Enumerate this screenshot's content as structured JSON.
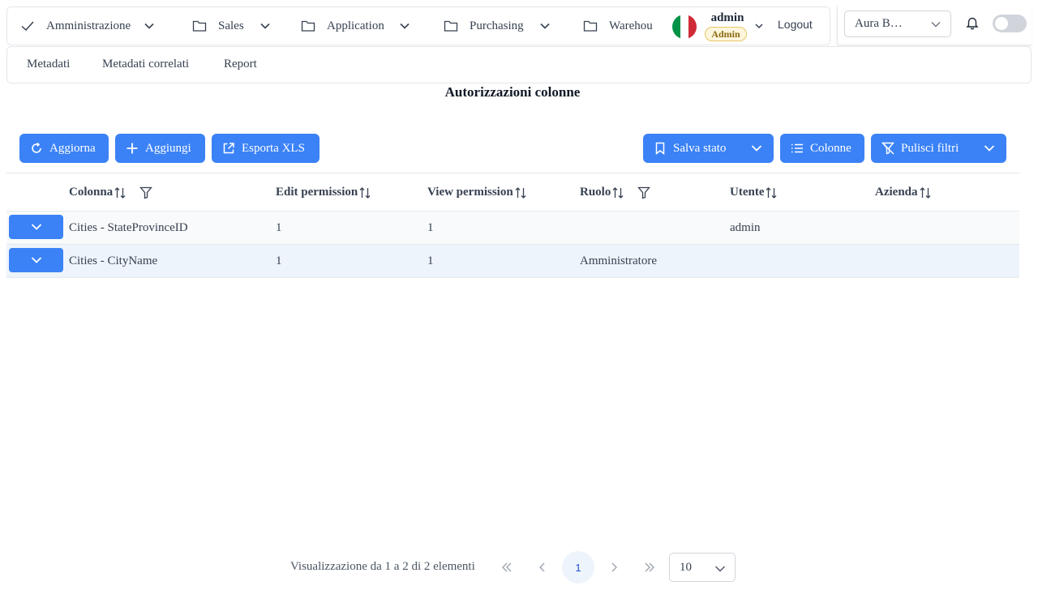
{
  "nav": {
    "items": [
      {
        "label": "Amministrazione",
        "icon": "check-icon"
      },
      {
        "label": "Sales",
        "icon": "folder-icon"
      },
      {
        "label": "Application",
        "icon": "folder-icon"
      },
      {
        "label": "Purchasing",
        "icon": "folder-icon"
      },
      {
        "label": "Warehou",
        "icon": "folder-icon"
      }
    ],
    "user": {
      "name": "admin",
      "role": "Admin",
      "flag": "italy-flag"
    },
    "logout_label": "Logout"
  },
  "company_select": {
    "value": "Aura B…"
  },
  "submenu": {
    "tabs": [
      "Metadati",
      "Metadati correlati",
      "Report"
    ]
  },
  "page_title": "Autorizzazioni colonne",
  "toolbar": {
    "refresh": "Aggiorna",
    "add": "Aggiungi",
    "export": "Esporta XLS",
    "save_state": "Salva stato",
    "columns": "Colonne",
    "clear_filters": "Pulisci filtri"
  },
  "table": {
    "columns": [
      {
        "label": "Colonna",
        "filter": true
      },
      {
        "label": "Edit permission",
        "filter": false
      },
      {
        "label": "View permission",
        "filter": false
      },
      {
        "label": "Ruolo",
        "filter": true
      },
      {
        "label": "Utente",
        "filter": false
      },
      {
        "label": "Azienda",
        "filter": false
      }
    ],
    "rows": [
      [
        "Cities - StateProvinceID",
        "1",
        "1",
        "",
        "admin",
        ""
      ],
      [
        "Cities - CityName",
        "1",
        "1",
        "Amministratore",
        "",
        ""
      ]
    ]
  },
  "paginator": {
    "summary": "Visualizzazione da 1 a 2 di 2 elementi",
    "current_page": "1",
    "rows_per_page": "10"
  },
  "colors": {
    "primary": "#3b82f6",
    "border": "#e5e7eb",
    "row_alt": "#eef4fb"
  }
}
